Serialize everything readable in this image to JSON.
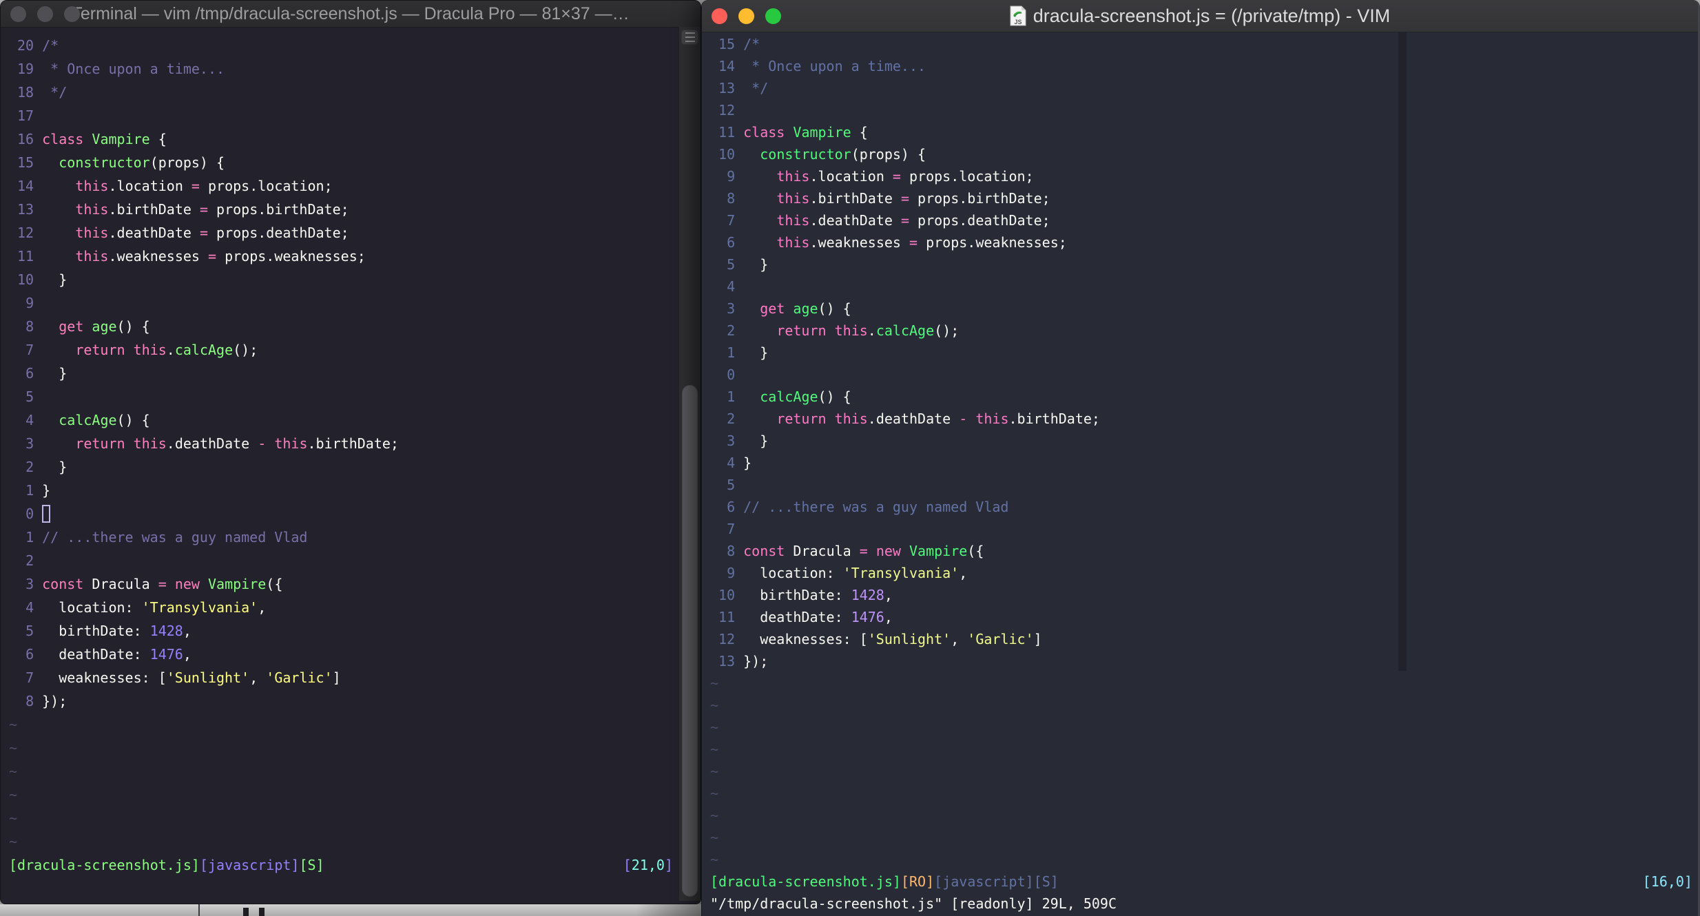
{
  "left_window": {
    "title": "Terminal — vim /tmp/dracula-screenshot.js — Dracula Pro — 81×37 —…",
    "tilde_count": 6,
    "status_left": [
      [
        "[",
        "green"
      ],
      [
        "dracula-screenshot.js",
        "green"
      ],
      [
        "]",
        "green"
      ],
      [
        "[",
        "purple"
      ],
      [
        "javascript",
        "purple"
      ],
      [
        "]",
        "purple"
      ],
      [
        "[",
        "green"
      ],
      [
        "S",
        "green"
      ],
      [
        "]",
        "green"
      ]
    ],
    "status_right": [
      [
        "[",
        "purple"
      ],
      [
        "21,0",
        "cyan"
      ],
      [
        "]",
        "purple"
      ]
    ],
    "command_line": ""
  },
  "right_window": {
    "title": "dracula-screenshot.js = (/private/tmp) - VIM",
    "tilde_count": 9,
    "status_left": [
      [
        "[",
        "green"
      ],
      [
        "dracula-screenshot.js",
        "green"
      ],
      [
        "]",
        "green"
      ],
      [
        "[",
        "orange"
      ],
      [
        "RO",
        "orange"
      ],
      [
        "]",
        "orange"
      ],
      [
        "[",
        "slate"
      ],
      [
        "javascript",
        "slate"
      ],
      [
        "]",
        "slate"
      ],
      [
        "[",
        "slate"
      ],
      [
        "S",
        "slate"
      ],
      [
        "]",
        "slate"
      ]
    ],
    "status_right": [
      [
        "[",
        "cyan"
      ],
      [
        "16,0",
        "cyan"
      ],
      [
        "]",
        "cyan"
      ]
    ],
    "command_line": "\"/tmp/dracula-screenshot.js\" [readonly] 29L, 509C"
  },
  "palettes": {
    "left": {
      "bg": "#22212C",
      "fg": "#F8F8F2",
      "comment": "#7970A9",
      "pink": "#FF80BF",
      "green": "#8AFF80",
      "purple": "#9580FF",
      "yellow": "#FFFF80",
      "cyan": "#80FFEA",
      "orange": "#FFCA80",
      "slate": "#7970A9",
      "linenr": "#7970A9",
      "nontext": "#514B66"
    },
    "right": {
      "bg": "#282A36",
      "fg": "#F8F8F2",
      "comment": "#6272A4",
      "pink": "#FF79C6",
      "green": "#50FA7B",
      "purple": "#BD93F9",
      "yellow": "#F1FA8C",
      "cyan": "#8BE9FD",
      "orange": "#FFB86C",
      "slate": "#6272A4",
      "linenr": "#6272A4",
      "nontext": "#4A4F69"
    }
  },
  "code": {
    "tilde": "~",
    "left_cursor_line_index": 20,
    "lines": [
      {
        "ln": "20",
        "rn": "15",
        "segs": [
          [
            "/*",
            "comment"
          ]
        ]
      },
      {
        "ln": "19",
        "rn": "14",
        "segs": [
          [
            " * Once upon a time...",
            "comment"
          ]
        ]
      },
      {
        "ln": "18",
        "rn": "13",
        "segs": [
          [
            " */",
            "comment"
          ]
        ]
      },
      {
        "ln": "17",
        "rn": "12",
        "segs": []
      },
      {
        "ln": "16",
        "rn": "11",
        "segs": [
          [
            "class",
            "pink"
          ],
          [
            " ",
            "fg"
          ],
          [
            "Vampire",
            "green"
          ],
          [
            " {",
            "fg"
          ]
        ]
      },
      {
        "ln": "15",
        "rn": "10",
        "segs": [
          [
            "  ",
            "fg"
          ],
          [
            "constructor",
            "green"
          ],
          [
            "(props) {",
            "fg"
          ]
        ]
      },
      {
        "ln": "14",
        "rn": "9",
        "segs": [
          [
            "    ",
            "fg"
          ],
          [
            "this",
            "pink"
          ],
          [
            ".location ",
            "fg"
          ],
          [
            "=",
            "pink"
          ],
          [
            " props.location;",
            "fg"
          ]
        ]
      },
      {
        "ln": "13",
        "rn": "8",
        "segs": [
          [
            "    ",
            "fg"
          ],
          [
            "this",
            "pink"
          ],
          [
            ".birthDate ",
            "fg"
          ],
          [
            "=",
            "pink"
          ],
          [
            " props.birthDate;",
            "fg"
          ]
        ]
      },
      {
        "ln": "12",
        "rn": "7",
        "segs": [
          [
            "    ",
            "fg"
          ],
          [
            "this",
            "pink"
          ],
          [
            ".deathDate ",
            "fg"
          ],
          [
            "=",
            "pink"
          ],
          [
            " props.deathDate;",
            "fg"
          ]
        ]
      },
      {
        "ln": "11",
        "rn": "6",
        "segs": [
          [
            "    ",
            "fg"
          ],
          [
            "this",
            "pink"
          ],
          [
            ".weaknesses ",
            "fg"
          ],
          [
            "=",
            "pink"
          ],
          [
            " props.weaknesses;",
            "fg"
          ]
        ]
      },
      {
        "ln": "10",
        "rn": "5",
        "segs": [
          [
            "  }",
            "fg"
          ]
        ]
      },
      {
        "ln": "9",
        "rn": "4",
        "segs": []
      },
      {
        "ln": "8",
        "rn": "3",
        "segs": [
          [
            "  ",
            "fg"
          ],
          [
            "get",
            "pink"
          ],
          [
            " ",
            "fg"
          ],
          [
            "age",
            "green"
          ],
          [
            "() {",
            "fg"
          ]
        ]
      },
      {
        "ln": "7",
        "rn": "2",
        "segs": [
          [
            "    ",
            "fg"
          ],
          [
            "return",
            "pink"
          ],
          [
            " ",
            "fg"
          ],
          [
            "this",
            "pink"
          ],
          [
            ".",
            "fg"
          ],
          [
            "calcAge",
            "green"
          ],
          [
            "();",
            "fg"
          ]
        ]
      },
      {
        "ln": "6",
        "rn": "1",
        "segs": [
          [
            "  }",
            "fg"
          ]
        ]
      },
      {
        "ln": "5",
        "rn": "0",
        "segs": []
      },
      {
        "ln": "4",
        "rn": "1",
        "segs": [
          [
            "  ",
            "fg"
          ],
          [
            "calcAge",
            "green"
          ],
          [
            "() {",
            "fg"
          ]
        ]
      },
      {
        "ln": "3",
        "rn": "2",
        "segs": [
          [
            "    ",
            "fg"
          ],
          [
            "return",
            "pink"
          ],
          [
            " ",
            "fg"
          ],
          [
            "this",
            "pink"
          ],
          [
            ".deathDate ",
            "fg"
          ],
          [
            "-",
            "pink"
          ],
          [
            " ",
            "fg"
          ],
          [
            "this",
            "pink"
          ],
          [
            ".birthDate;",
            "fg"
          ]
        ]
      },
      {
        "ln": "2",
        "rn": "3",
        "segs": [
          [
            "  }",
            "fg"
          ]
        ]
      },
      {
        "ln": "1",
        "rn": "4",
        "segs": [
          [
            "}",
            "fg"
          ]
        ]
      },
      {
        "ln": "0",
        "rn": "5",
        "segs": []
      },
      {
        "ln": "1",
        "rn": "6",
        "segs": [
          [
            "// ...there was a guy named Vlad",
            "comment"
          ]
        ]
      },
      {
        "ln": "2",
        "rn": "7",
        "segs": []
      },
      {
        "ln": "3",
        "rn": "8",
        "segs": [
          [
            "const",
            "pink"
          ],
          [
            " Dracula ",
            "fg"
          ],
          [
            "=",
            "pink"
          ],
          [
            " ",
            "fg"
          ],
          [
            "new",
            "pink"
          ],
          [
            " ",
            "fg"
          ],
          [
            "Vampire",
            "green"
          ],
          [
            "({",
            "fg"
          ]
        ]
      },
      {
        "ln": "4",
        "rn": "9",
        "segs": [
          [
            "  location: ",
            "fg"
          ],
          [
            "'Transylvania'",
            "yellow"
          ],
          [
            ",",
            "fg"
          ]
        ]
      },
      {
        "ln": "5",
        "rn": "10",
        "segs": [
          [
            "  birthDate: ",
            "fg"
          ],
          [
            "1428",
            "purple"
          ],
          [
            ",",
            "fg"
          ]
        ]
      },
      {
        "ln": "6",
        "rn": "11",
        "segs": [
          [
            "  deathDate: ",
            "fg"
          ],
          [
            "1476",
            "purple"
          ],
          [
            ",",
            "fg"
          ]
        ]
      },
      {
        "ln": "7",
        "rn": "12",
        "segs": [
          [
            "  weaknesses: [",
            "fg"
          ],
          [
            "'Sunlight'",
            "yellow"
          ],
          [
            ", ",
            "fg"
          ],
          [
            "'Garlic'",
            "yellow"
          ],
          [
            "]",
            "fg"
          ]
        ]
      },
      {
        "ln": "8",
        "rn": "13",
        "segs": [
          [
            "});",
            "fg"
          ]
        ]
      }
    ]
  }
}
